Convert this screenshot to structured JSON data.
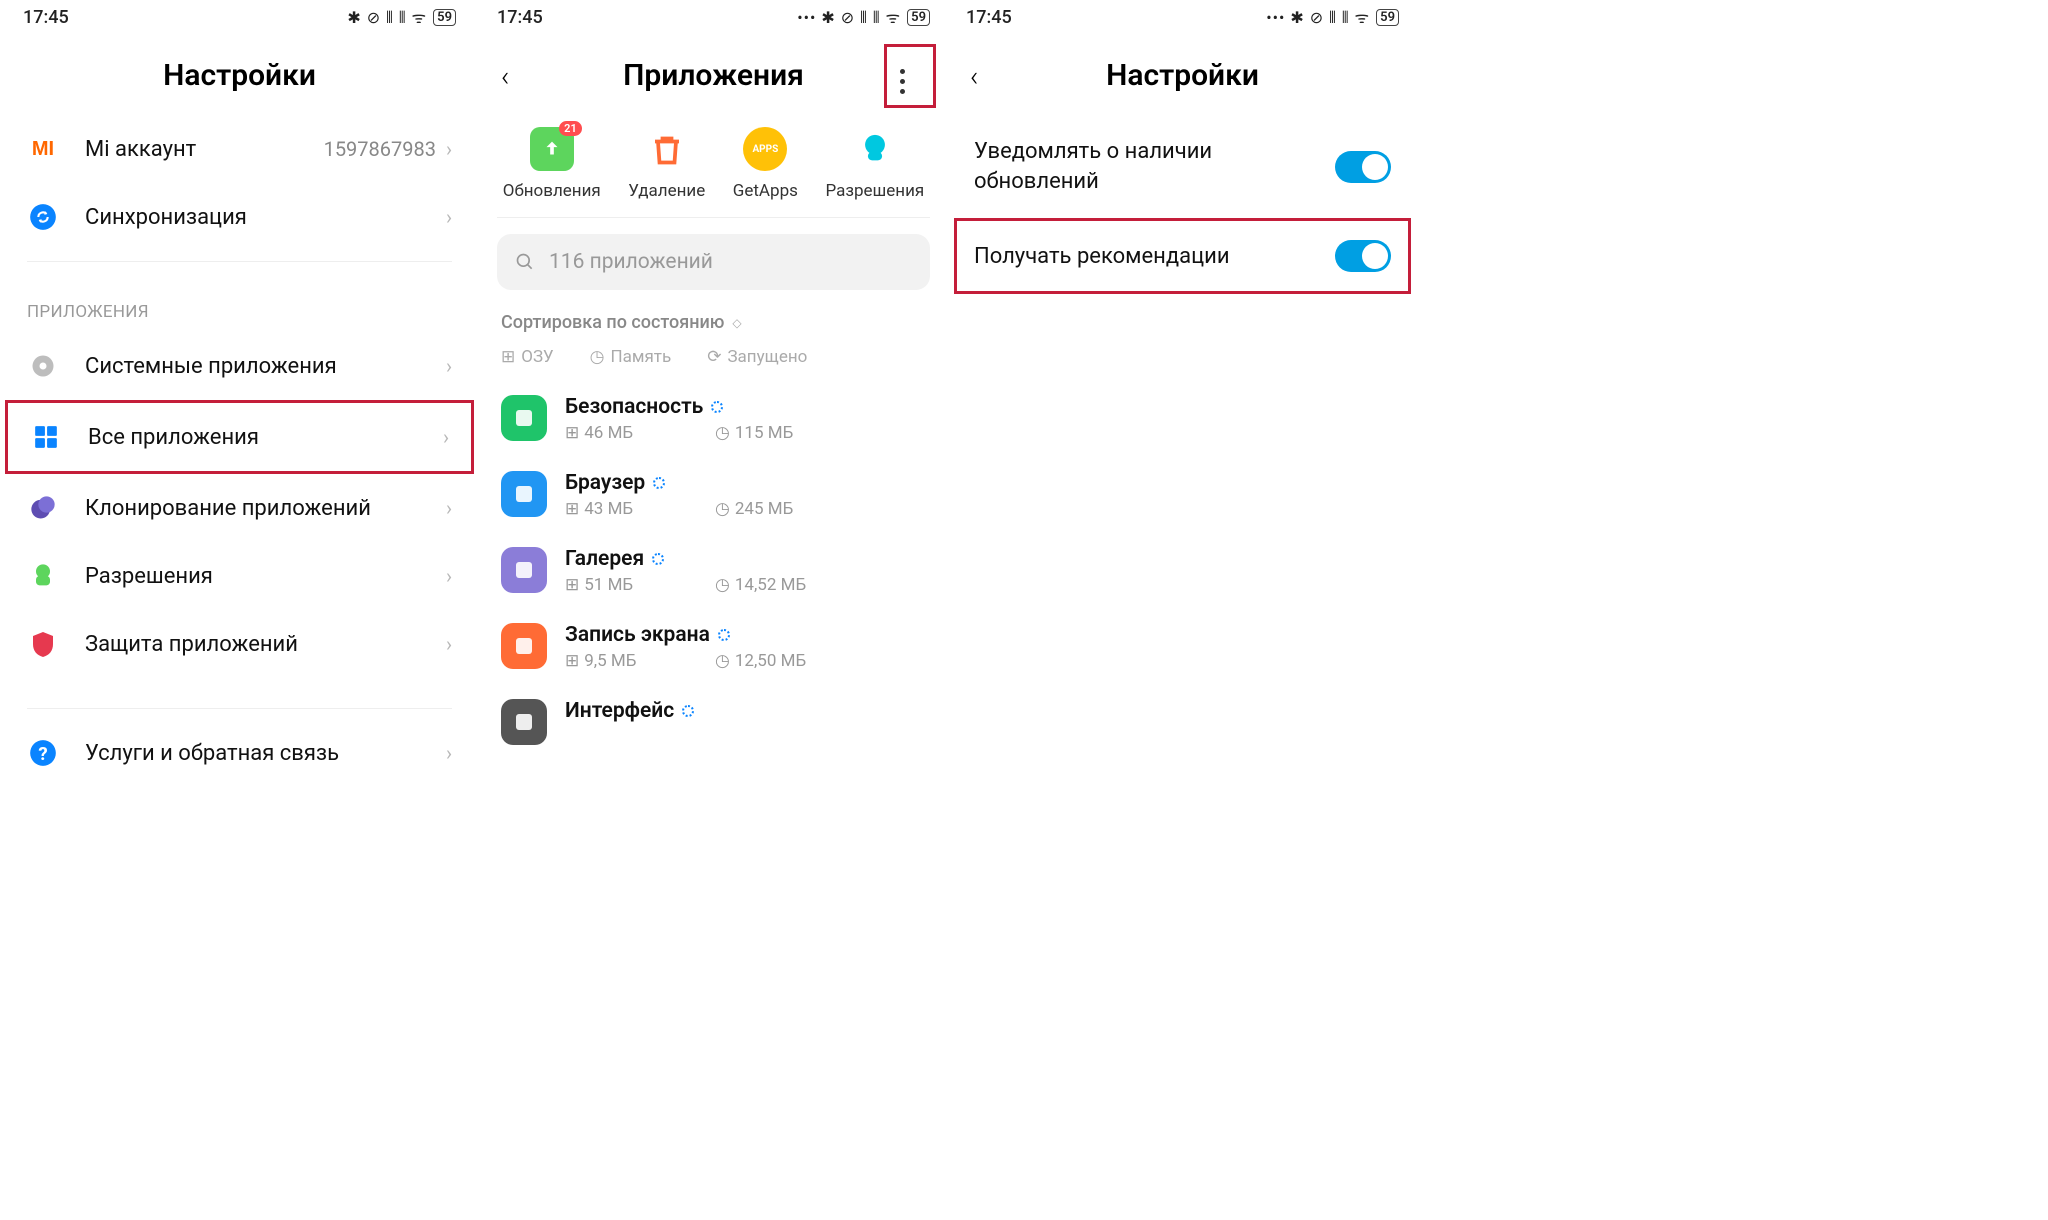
{
  "status": {
    "time": "17:45",
    "battery": "59"
  },
  "s1": {
    "title": "Настройки",
    "account": {
      "label": "Mi аккаунт",
      "value": "1597867983"
    },
    "sync": {
      "label": "Синхронизация"
    },
    "section": "ПРИЛОЖЕНИЯ",
    "rows": {
      "system": "Системные приложения",
      "all": "Все приложения",
      "clone": "Клонирование приложений",
      "perms": "Разрешения",
      "protect": "Защита приложений",
      "help": "Услуги и обратная связь"
    }
  },
  "s2": {
    "title": "Приложения",
    "actions": {
      "updates": "Обновления",
      "updates_badge": "21",
      "delete": "Удаление",
      "getapps": "GetApps",
      "perms": "Разрешения"
    },
    "search": "116 приложений",
    "sort": "Сортировка по состоянию",
    "filters": {
      "ram": "ОЗУ",
      "storage": "Память",
      "running": "Запущено"
    },
    "apps": [
      {
        "name": "Безопасность",
        "size1": "46 МБ",
        "size2": "115 МБ",
        "color": "#1fc46a"
      },
      {
        "name": "Браузер",
        "size1": "43 МБ",
        "size2": "245 МБ",
        "color": "#2196f3"
      },
      {
        "name": "Галерея",
        "size1": "51 МБ",
        "size2": "14,52 МБ",
        "color": "#8b7dd8"
      },
      {
        "name": "Запись экрана",
        "size1": "9,5 МБ",
        "size2": "12,50 МБ",
        "color": "#ff6b35"
      },
      {
        "name": "Интерфейс",
        "size1": "",
        "size2": "",
        "color": "#555"
      }
    ]
  },
  "s3": {
    "title": "Настройки",
    "toggle1": "Уведомлять о наличии обновлений",
    "toggle2": "Получать рекомендации"
  }
}
